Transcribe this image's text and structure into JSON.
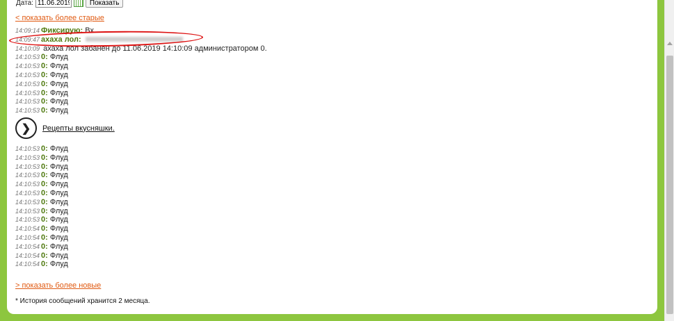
{
  "date_filter": {
    "label": "Дата:",
    "value": "11.06.2019",
    "button": "Показать"
  },
  "links": {
    "older": "< показать более старые",
    "newer": "> показать более новые"
  },
  "messages_top": [
    {
      "time": "14:09:14",
      "nick": "Фиксирую:",
      "text": " Вх",
      "blurred": false
    },
    {
      "time": "14:09:47",
      "nick": "ахаха лол:",
      "text": "",
      "blurred": true
    },
    {
      "time": "14:10:09",
      "nick": "",
      "text": " ахаха лол забанен до 11.06.2019 14:10:09 администратором 0.",
      "blurred": false
    },
    {
      "time": "14:10:53",
      "nick": "0:",
      "text": " Флуд",
      "blurred": false
    },
    {
      "time": "14:10:53",
      "nick": "0:",
      "text": " Флуд",
      "blurred": false
    },
    {
      "time": "14:10:53",
      "nick": "0:",
      "text": " Флуд",
      "blurred": false
    },
    {
      "time": "14:10:53",
      "nick": "0:",
      "text": " Флуд",
      "blurred": false
    },
    {
      "time": "14:10:53",
      "nick": "0:",
      "text": " Флуд",
      "blurred": false
    },
    {
      "time": "14:10:53",
      "nick": "0:",
      "text": " Флуд",
      "blurred": false
    },
    {
      "time": "14:10:53",
      "nick": "0:",
      "text": " Флуд",
      "blurred": false
    }
  ],
  "promo": {
    "icon": "chevron-right-icon",
    "text": "Рецепты вкусняшки."
  },
  "messages_bottom": [
    {
      "time": "14:10:53",
      "nick": "0:",
      "text": " Флуд",
      "blurred": false
    },
    {
      "time": "14:10:53",
      "nick": "0:",
      "text": " Флуд",
      "blurred": false
    },
    {
      "time": "14:10:53",
      "nick": "0:",
      "text": " Флуд",
      "blurred": false
    },
    {
      "time": "14:10:53",
      "nick": "0:",
      "text": " Флуд",
      "blurred": false
    },
    {
      "time": "14:10:53",
      "nick": "0:",
      "text": " Флуд",
      "blurred": false
    },
    {
      "time": "14:10:53",
      "nick": "0:",
      "text": " Флуд",
      "blurred": false
    },
    {
      "time": "14:10:53",
      "nick": "0:",
      "text": " Флуд",
      "blurred": false
    },
    {
      "time": "14:10:53",
      "nick": "0:",
      "text": " Флуд",
      "blurred": false
    },
    {
      "time": "14:10:53",
      "nick": "0:",
      "text": " Флуд",
      "blurred": false
    },
    {
      "time": "14:10:54",
      "nick": "0:",
      "text": " Флуд",
      "blurred": false
    },
    {
      "time": "14:10:54",
      "nick": "0:",
      "text": " Флуд",
      "blurred": false
    },
    {
      "time": "14:10:54",
      "nick": "0:",
      "text": " Флуд",
      "blurred": false
    },
    {
      "time": "14:10:54",
      "nick": "0:",
      "text": " Флуд",
      "blurred": false
    },
    {
      "time": "14:10:54",
      "nick": "0:",
      "text": " Флуд",
      "blurred": false
    }
  ],
  "footnote": "* История сообщений хранится 2 месяца.",
  "colors": {
    "page_bg": "#8dc63f",
    "link": "#e05a12",
    "nick": "#4f7a0f",
    "highlight": "#dd1111"
  }
}
